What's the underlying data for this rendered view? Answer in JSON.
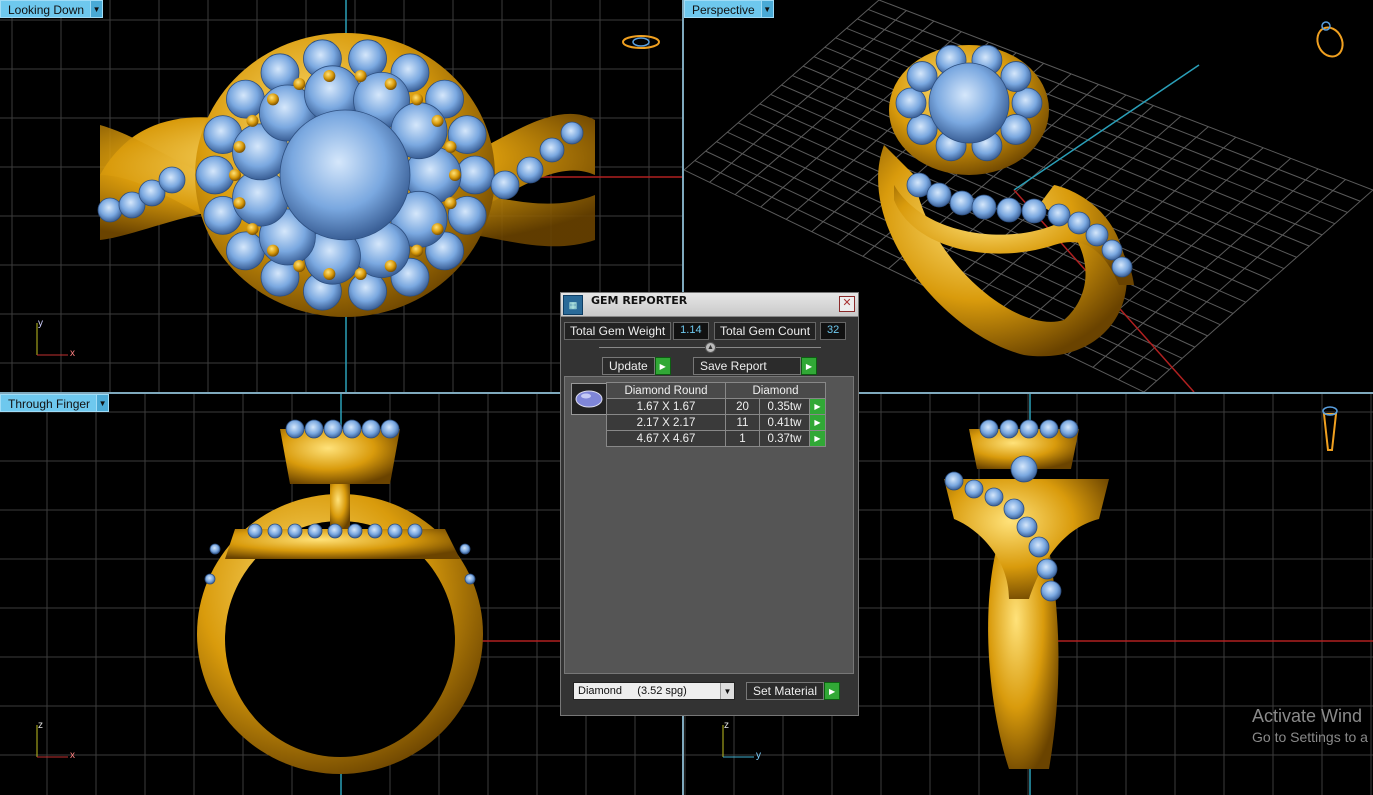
{
  "viewports": {
    "top_left": {
      "label": "Looking Down",
      "axis_v": "y",
      "axis_h": "x"
    },
    "top_right": {
      "label": "Perspective"
    },
    "bottom_left": {
      "label": "Through Finger",
      "axis_v": "z",
      "axis_h": "x"
    },
    "bottom_right": {
      "axis_v": "z",
      "axis_h": "y"
    }
  },
  "dialog": {
    "title": "GEM REPORTER",
    "total_weight_label": "Total Gem Weight",
    "total_weight_value": "1.14",
    "total_count_label": "Total Gem Count",
    "total_count_value": "32",
    "update_label": "Update",
    "save_report_label": "Save Report",
    "table": {
      "headers": [
        "Diamond Round",
        "Diamond"
      ],
      "rows": [
        {
          "size": "1.67 X 1.67",
          "count": "20",
          "weight": "0.35tw"
        },
        {
          "size": "2.17 X 2.17",
          "count": "11",
          "weight": "0.41tw"
        },
        {
          "size": "4.67 X 4.67",
          "count": "1",
          "weight": "0.37tw"
        }
      ]
    },
    "material_select": "Diamond     (3.52 spg)",
    "set_material_label": "Set Material"
  },
  "watermark": {
    "line1": "Activate Wind",
    "line2": "Go to Settings to a"
  },
  "colors": {
    "label_bg": "#6ec8ee",
    "gold": "#e0a81a",
    "gem": "#7aaee6",
    "go_button": "#31a836"
  }
}
